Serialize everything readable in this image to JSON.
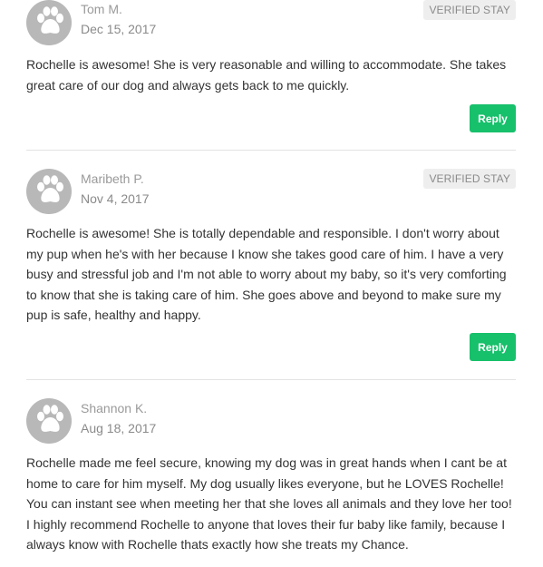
{
  "reviews": [
    {
      "name": "Tom M.",
      "date": "Dec 15, 2017",
      "badge": "VERIFIED STAY",
      "text": "Rochelle is awesome! She is very reasonable and willing to accommodate. She takes great care of our dog and always gets back to me quickly.",
      "reply_label": "Reply",
      "avatar_icon": "paw-icon"
    },
    {
      "name": "Maribeth P.",
      "date": "Nov 4, 2017",
      "badge": "VERIFIED STAY",
      "text": "Rochelle is awesome! She is totally dependable and responsible. I don't worry about my pup when he's with her because I know she takes good care of him. I have a very busy and stressful job and I'm not able to worry about my baby, so it's very comforting to know that she is taking care of him. She goes above and beyond to make sure my pup is safe, healthy and happy.",
      "reply_label": "Reply",
      "avatar_icon": "paw-icon"
    },
    {
      "name": "Shannon K.",
      "date": "Aug 18, 2017",
      "text": "Rochelle made me feel secure, knowing my dog was in great hands when I cant be at home to care for him myself. My dog usually likes everyone, but he LOVES Rochelle! You can instant see when meeting her that she loves all animals and they love her too! I highly recommend Rochelle to anyone that loves their fur baby like family, because I always know with Rochelle thats exactly how she treats my Chance.",
      "avatar_icon": "paw-icon"
    }
  ],
  "colors": {
    "reply_button": "#17c06b",
    "badge_bg": "#eeeeee",
    "avatar_bg": "#b8b8b8",
    "divider": "#e3e3e3"
  }
}
